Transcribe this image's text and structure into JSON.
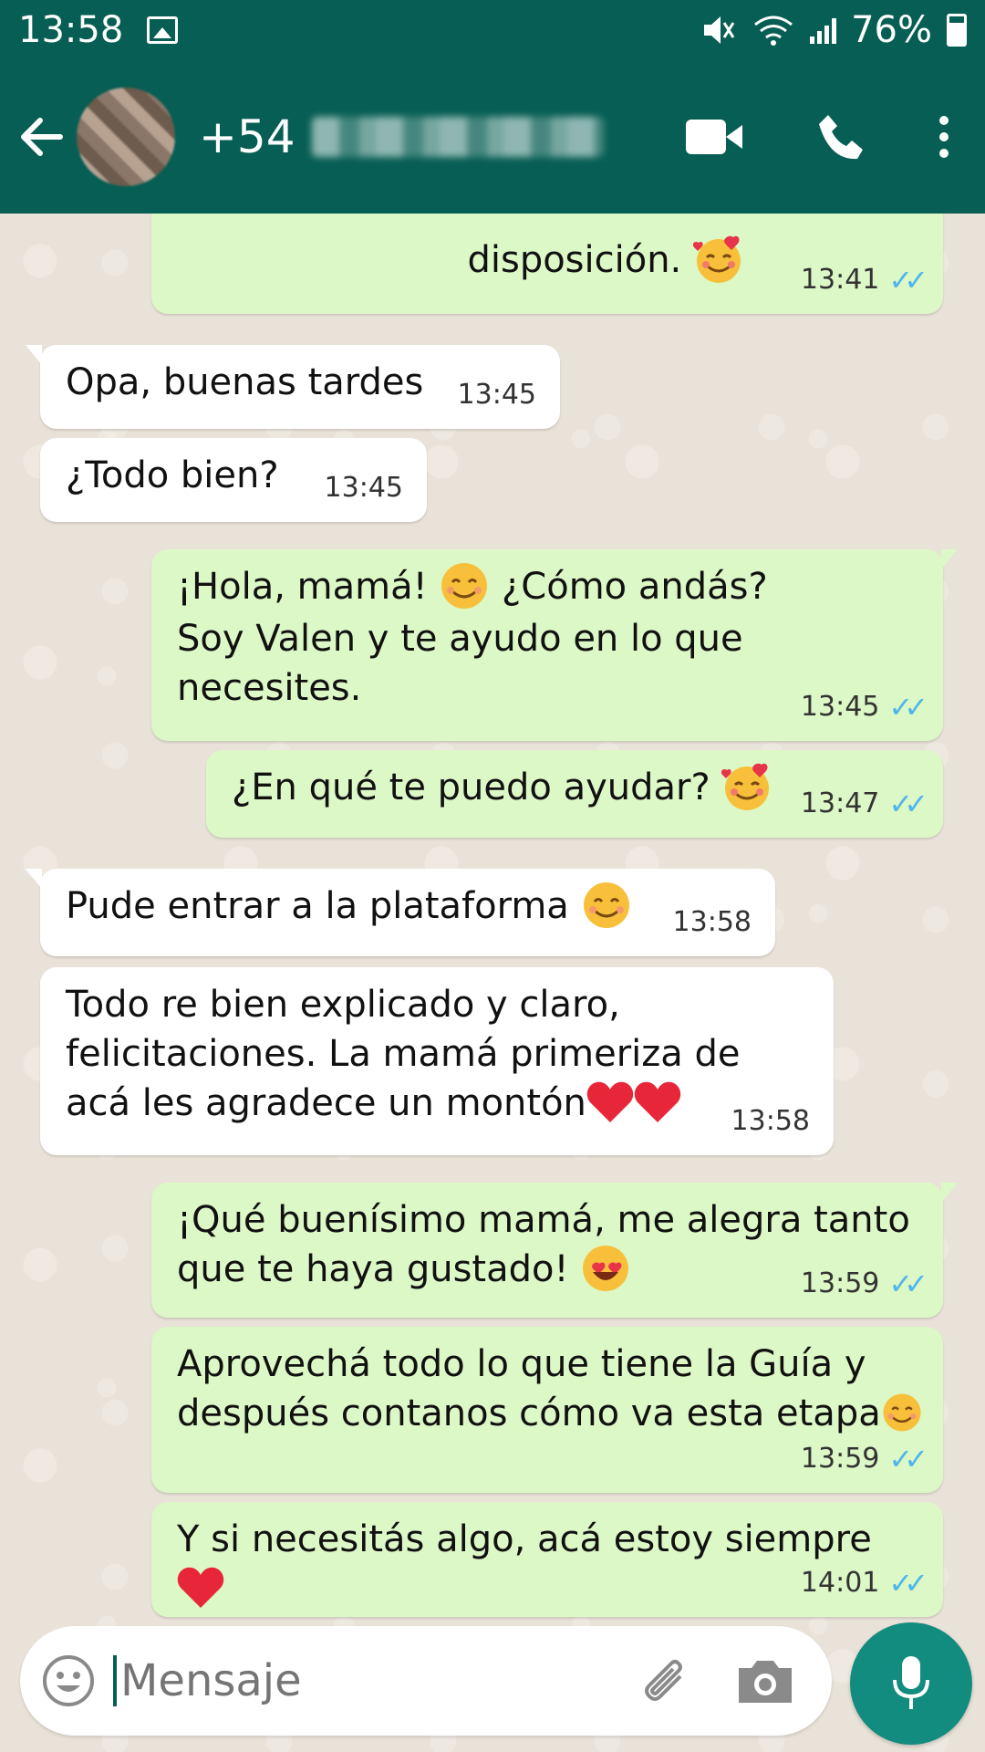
{
  "status_bar": {
    "time": "13:58",
    "battery": "76%"
  },
  "header": {
    "contact_prefix": "+54"
  },
  "messages": [
    {
      "direction": "out",
      "text": "disposición.",
      "time": "13:41"
    },
    {
      "direction": "in",
      "text": "Opa, buenas tardes",
      "time": "13:45"
    },
    {
      "direction": "in",
      "text": "¿Todo bien?",
      "time": "13:45"
    },
    {
      "direction": "out",
      "text": "¡Hola, mamá! ",
      "text2": " ¿Cómo andás?",
      "text3": "Soy Valen y te ayudo en lo que",
      "text4": "necesites.",
      "time": "13:45"
    },
    {
      "direction": "out",
      "text": "¿En qué te puedo ayudar? ",
      "time": "13:47"
    },
    {
      "direction": "in",
      "text": "Pude entrar a la plataforma ",
      "time": "13:58"
    },
    {
      "direction": "in",
      "text": "Todo re bien explicado y claro,",
      "text2": "felicitaciones. La mamá primeriza de",
      "text3": "acá les agradece un montón",
      "time": "13:58"
    },
    {
      "direction": "out",
      "text": "¡Qué buenísimo mamá, me alegra tanto",
      "text2": "que te haya gustado! ",
      "time": "13:59"
    },
    {
      "direction": "out",
      "text": "Aprovechá todo lo que tiene la Guía y",
      "text2": "después contanos cómo va esta etapa",
      "time": "13:59"
    },
    {
      "direction": "out",
      "text": "Y si necesitás algo, acá estoy siempre ",
      "time": "14:01"
    }
  ],
  "input": {
    "placeholder": "Mensaje"
  },
  "colors": {
    "header": "#075e54",
    "outgoing_bubble": "#dcf8c6",
    "incoming_bubble": "#ffffff",
    "read_ticks": "#4fb6ec",
    "mic_button": "#128c7e"
  },
  "icons": {
    "back": "arrow-left-icon",
    "video": "video-call-icon",
    "call": "phone-icon",
    "menu": "more-vert-icon",
    "emoji": "smiley-icon",
    "attach": "paperclip-icon",
    "camera": "camera-icon",
    "mic": "mic-icon",
    "read_status": "double-check-icon"
  }
}
